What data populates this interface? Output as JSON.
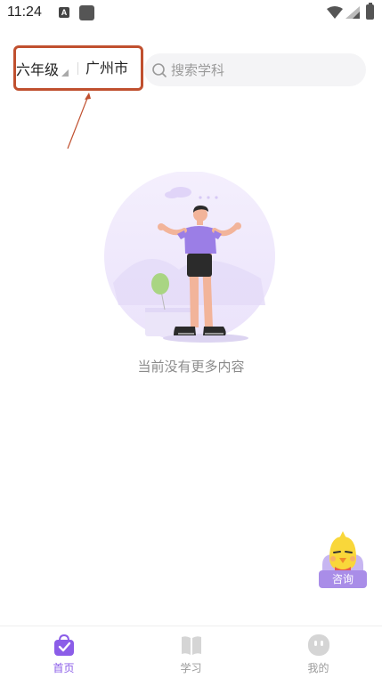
{
  "status_bar": {
    "time": "11:24",
    "notification_icon": "A",
    "icons": [
      "text-a-icon",
      "app-square-icon",
      "wifi-icon",
      "signal-icon",
      "battery-icon"
    ]
  },
  "top_bar": {
    "grade": "六年级",
    "city": "广州市",
    "search": {
      "placeholder": "搜索学科"
    }
  },
  "empty_state": {
    "message": "当前没有更多内容",
    "illustration": "shrugging-person-with-balloon"
  },
  "consult": {
    "label": "咨询",
    "icon": "chick-mascot-icon"
  },
  "bottom_nav": {
    "items": [
      {
        "label": "首页",
        "icon": "home-bag-icon",
        "active": true
      },
      {
        "label": "学习",
        "icon": "book-icon",
        "active": false
      },
      {
        "label": "我的",
        "icon": "profile-face-icon",
        "active": false
      }
    ]
  },
  "colors": {
    "accent": "#8b5de8",
    "highlight_box": "#c0502f",
    "search_bg": "#f4f4f6",
    "inactive": "#9a9a9a"
  }
}
